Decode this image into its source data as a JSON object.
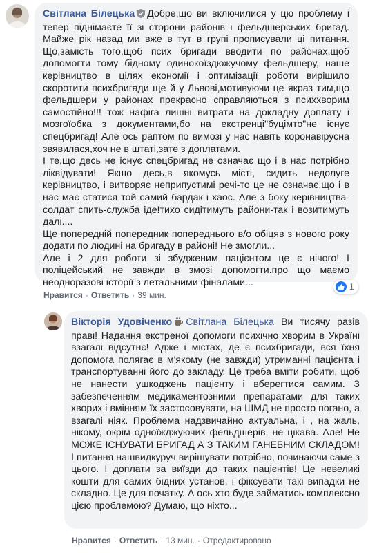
{
  "comments": [
    {
      "author": "Світлана Білецька",
      "badge_icon": "shield-icon",
      "text": "Добре,що ви включилися у цю проблему і тепер піднімаєте її зі сторони районів і фельдшерських бригад. Майже рік назад ми вже в тут в групі прописували ці питання. Що,замість того,щоб псих бригади вводити по районах,щоб допомогти тому бідному одинокоїздюжучому фельдшеру, наше керівництво в цілях економії і оптимізації роботи вирішило скоротити психбригади ще й у Львові,мотивуючи це якраз тим,що фельдшери у районах прекрасно справляються з психхворим самостійно!!! тож нафіга лишні витрати на докладну доплату і мозгоїобка з документами,бо на екстренці\"буцімто\"не існує спецбригад! Але ось раптом по вимозі у нас навіть коронавірусна звявилася,хоч не в штаті,зате з доплатами.\nІ те,що десь не існує спецбригад не означає що і в нас потрібно ліквідувати! Якщо десь,в якомусь місті, сидить недолуге керівництво, і витворяє неприпустимі речі-то це не означає,що і в нас має статися той самий бардак і хаос. Але з боку керівництва-солдат спить-служба іде!тихо сидітимуть райони-так і возитимуть далі....\nЩе попередній попередник попереднього в/о обіцяв з нового року додати по людині на бригаду в районі! Не змогли...\nАле і 2 для роботи зі збудженим пацієнтом це є нічого! І поліцейський не завжди в змозі допомогти.про що маємо неодноразові історії з летальними фіналами...",
      "actions": {
        "like": "Нравится",
        "reply": "Ответить",
        "time": "39 мин."
      },
      "reaction_count": "1"
    },
    {
      "author": "Вікторія Удовіченко",
      "badge_icon": "coffee-cup-icon",
      "mention": "Світлана Білецька",
      "text": "Ви тисячу разів праві! Надання екстреної допомоги психічно хворим в Україні взагалі відсутнє! Адже і містах, де є психбригади, вся їхня допомога полягає в м'якому (не завжди) утриманні пацієнта і транспортуванні його до закладу. Це треба вміти робити, щоб не нанести ушкоджень пацієнту і вберегтися самим. З забезпеченням медикаментозними препаратами для таких хворих і вмінням їх застосовувати, на ШМД не просто погано, а взагалі ніяк. Проблема надзвичайно актуальна, і , на жаль, нікому, окрім одноїжджуючих фельдшерів, не цікава. Але! Не МОЖЕ ІСНУВАТИ БРИГАД А З ТАКИМ ГАНЕБНИМ СКЛАДОМ! І питання нашвидкуруч вирішувати потрібно, починаючи саме з цього. І доплати за виїзди до таких пацієнтів! Це невеликі кошти для самих бідних установ, і фіксувати такі випадки не складно. Це для початку. А ось хто буде займатись комплексно цією проблемою? Думаю, що ніхто...",
      "actions": {
        "like": "Нравится",
        "reply": "Ответить",
        "time": "13 мин.",
        "edited": "Отредактировано"
      }
    }
  ],
  "colors": {
    "link": "#385898",
    "bubble": "#f2f3f5",
    "like_blue": "#2078f4",
    "meta": "#606770"
  }
}
